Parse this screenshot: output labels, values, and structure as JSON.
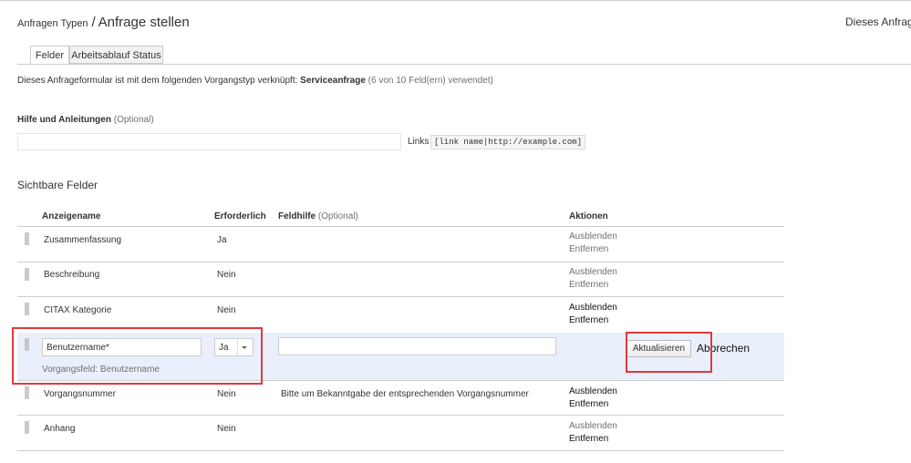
{
  "header": {
    "breadcrumb_link": "Anfragen Typen",
    "separator": "/",
    "title": "Anfrage stellen",
    "right_text": "Dieses Anfrage"
  },
  "tabs": [
    {
      "label": "Felder",
      "active": true
    },
    {
      "label": "Arbeitsablauf Status",
      "active": false
    }
  ],
  "description": {
    "text": "Dieses Anfrageformular ist mit dem folgenden Vorgangstyp verknüpft:",
    "issue_type": "Serviceanfrage",
    "usage": "(6 von 10 Feld(ern) verwendet)"
  },
  "help": {
    "label": "Hilfe und Anleitungen",
    "optional": "(Optional)",
    "value": "",
    "links_label": "Links",
    "links_example": "[link name|http://example.com]"
  },
  "visible_fields": {
    "title": "Sichtbare Felder",
    "headers": {
      "display_name": "Anzeigename",
      "required": "Erforderlich",
      "field_help": "Feldhilfe",
      "field_help_optional": "(Optional)",
      "actions": "Aktionen"
    },
    "rows": [
      {
        "name": "Zusammenfassung",
        "required": "Ja",
        "help": "",
        "hide": "Ausblenden",
        "remove": "Entfernen"
      },
      {
        "name": "Beschreibung",
        "required": "Nein",
        "help": "",
        "hide": "Ausblenden",
        "remove": "Entfernen"
      },
      {
        "name": "CITAX Kategorie",
        "required": "Nein",
        "help": "",
        "hide": "Ausblenden",
        "remove": "Entfernen"
      },
      {
        "name": "Vorgangsnummer",
        "required": "Nein",
        "help": "Bitte um Bekanntgabe der entsprechenden Vorgangsnummer",
        "hide": "Ausblenden",
        "remove": "Entfernen"
      },
      {
        "name": "Anhang",
        "required": "Nein",
        "help": "",
        "hide": "Ausblenden",
        "remove": "Entfernen"
      }
    ],
    "edit_row": {
      "name_value": "Benutzername*",
      "required_value": "Ja",
      "help_value": "",
      "sub_label": "Vorgangsfeld: Benutzername",
      "update_label": "Aktualisieren",
      "cancel_label": "Abbrechen"
    }
  },
  "colors": {
    "highlight_box": "#e03a3a",
    "edit_row_bg": "#e9f0fb",
    "muted_text": "#707070"
  }
}
